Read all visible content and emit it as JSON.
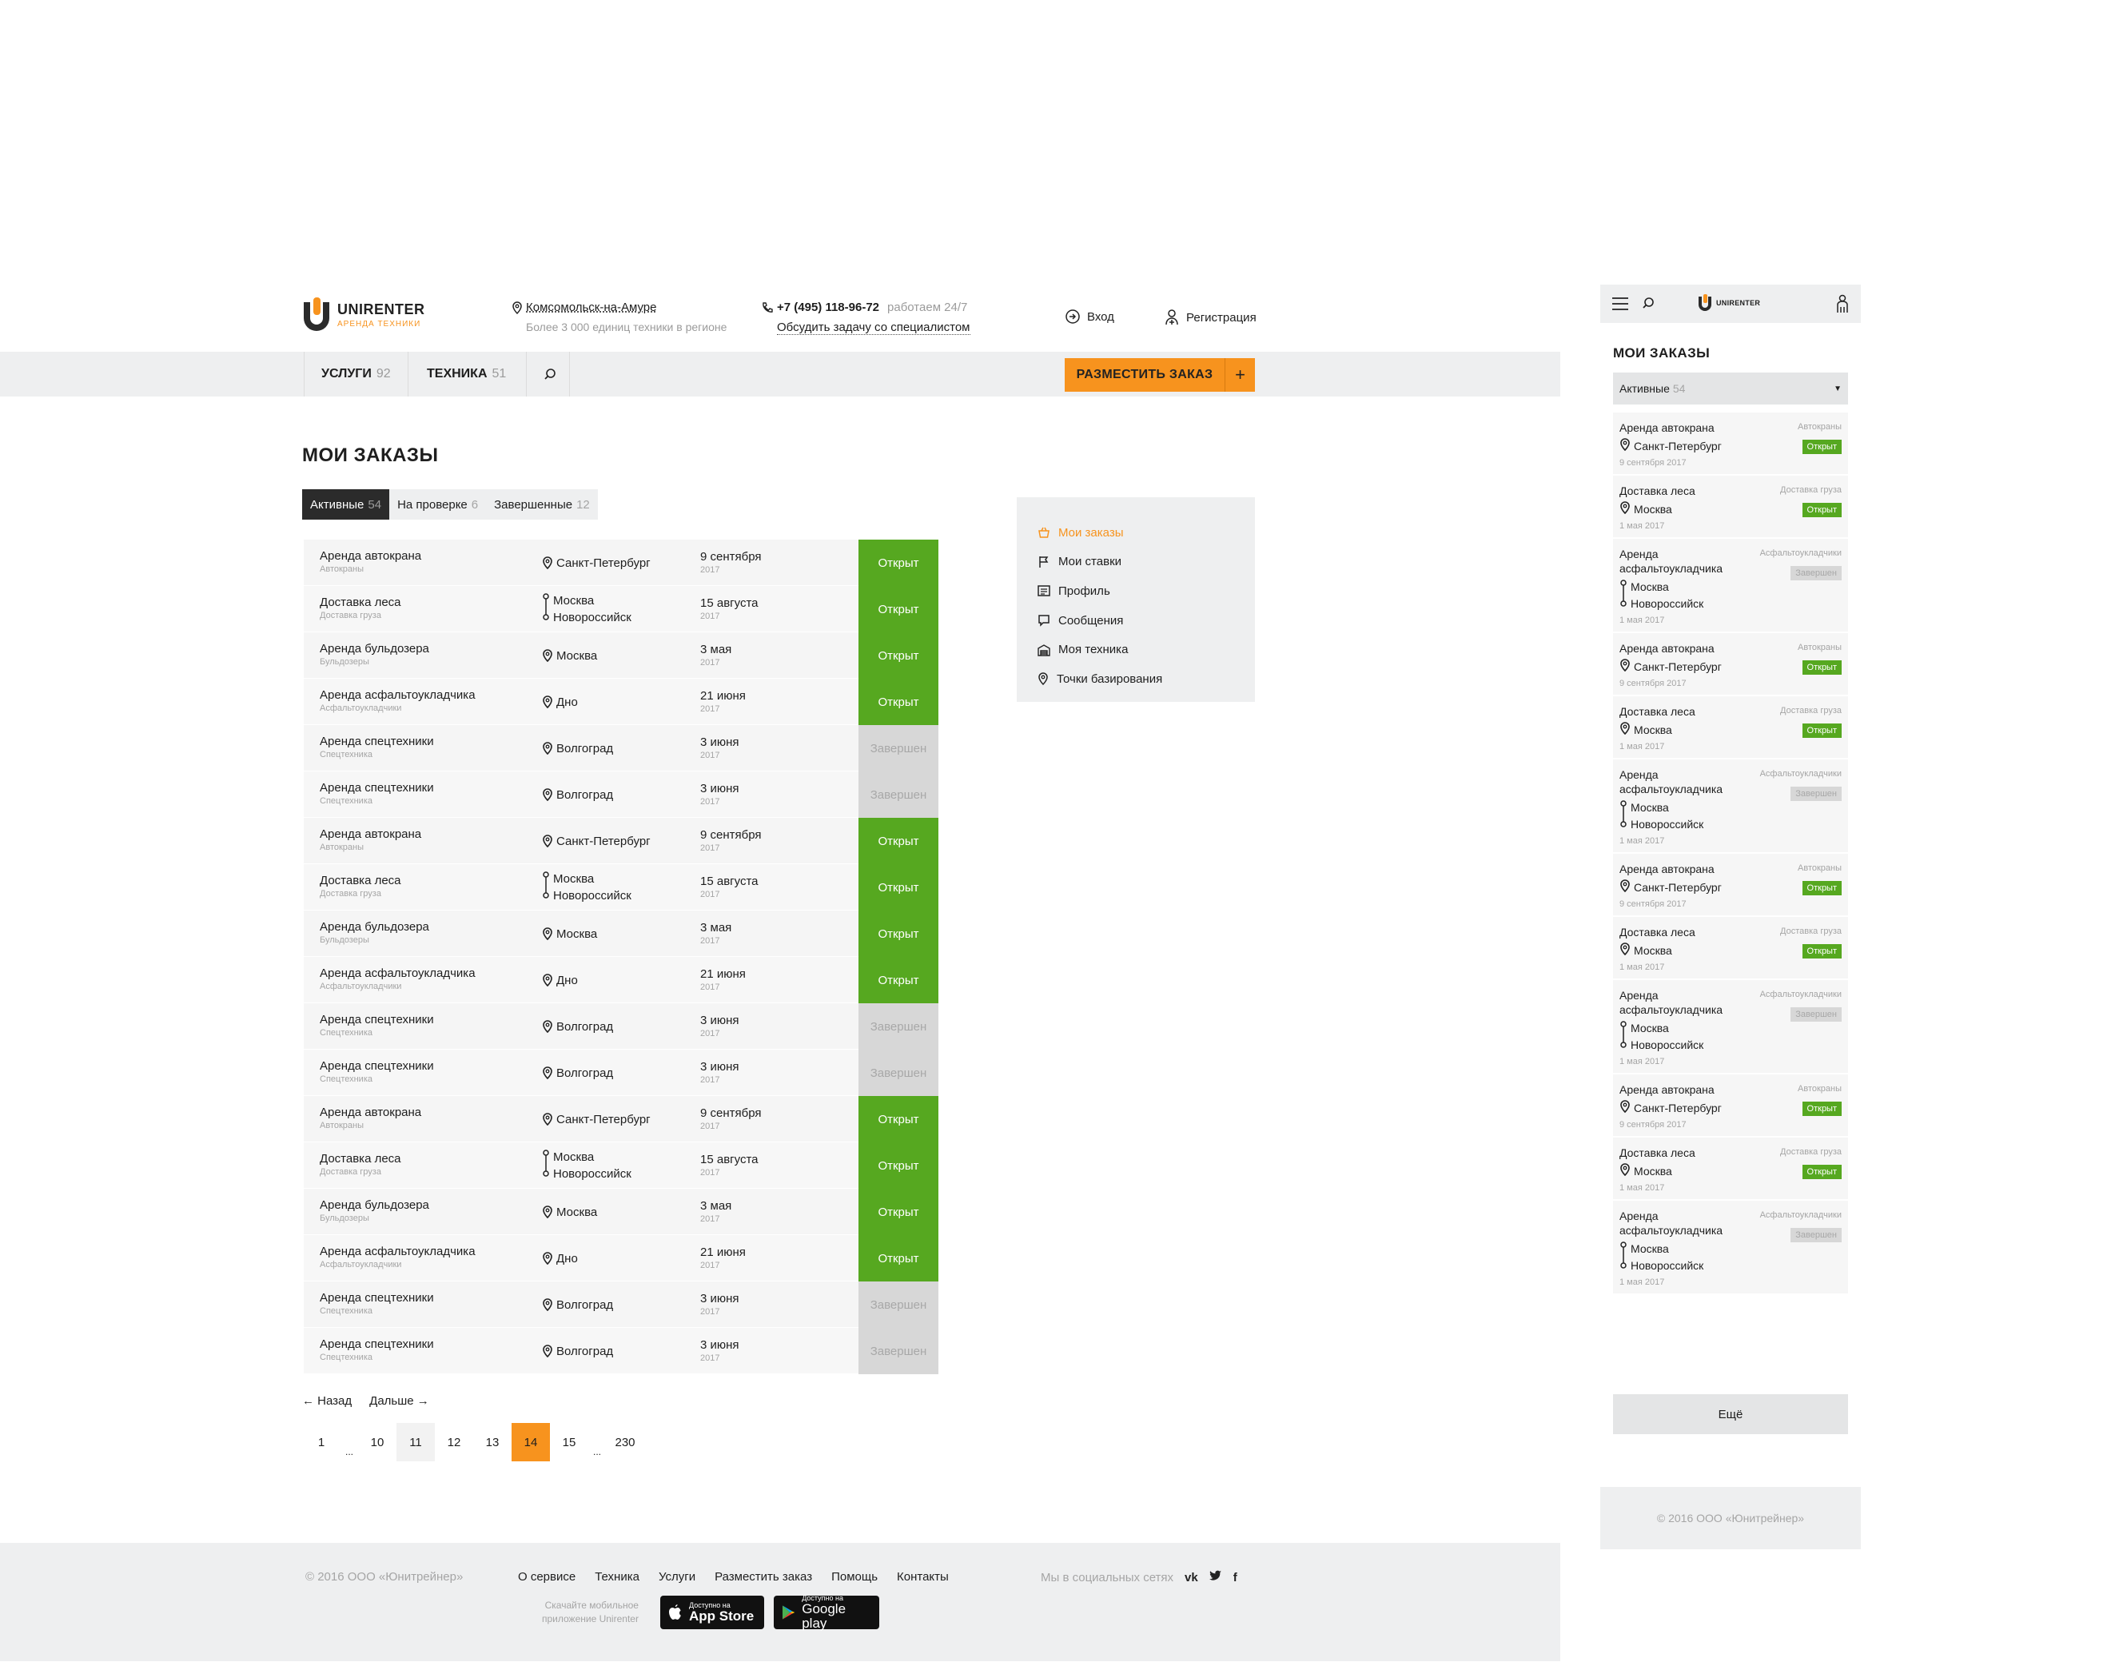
{
  "colors": {
    "accent": "#f7931e",
    "open": "#56a820",
    "done": "#d7d7d7",
    "dark": "#2b2b2b"
  },
  "header": {
    "logo_name": "UNIRENTER",
    "logo_sub": "АРЕНДА ТЕХНИКИ",
    "city": "Комсомольск-на-Амуре",
    "city_note": "Более 3 000 единиц техники в регионе",
    "phone": "+7 (495) 118-96-72",
    "phone_hours": "работаем 24/7",
    "phone_link": "Обсудить задачу со специалистом",
    "login": "Вход",
    "register": "Регистрация"
  },
  "nav": {
    "services": "УСЛУГИ",
    "services_count": "92",
    "equipment": "ТЕХНИКА",
    "equipment_count": "51",
    "place_order": "РАЗМЕСТИТЬ ЗАКАЗ",
    "plus": "+"
  },
  "main": {
    "title": "МОИ ЗАКАЗЫ",
    "tabs": [
      {
        "label": "Активные",
        "count": "54"
      },
      {
        "label": "На проверке",
        "count": "6"
      },
      {
        "label": "Завершенные",
        "count": "12"
      }
    ]
  },
  "orders": [
    {
      "title": "Аренда автокрана",
      "cat": "Автокраны",
      "from": "Санкт-Петербург",
      "to": "",
      "date": "9 сентября",
      "year": "2017",
      "status": "Открыт",
      "state": "open"
    },
    {
      "title": "Доставка леса",
      "cat": "Доставка груза",
      "from": "Москва",
      "to": "Новороссийск",
      "date": "15 августа",
      "year": "2017",
      "status": "Открыт",
      "state": "open"
    },
    {
      "title": "Аренда бульдозера",
      "cat": "Бульдозеры",
      "from": "Москва",
      "to": "",
      "date": "3 мая",
      "year": "2017",
      "status": "Открыт",
      "state": "open"
    },
    {
      "title": "Аренда асфальтоукладчика",
      "cat": "Асфальтоукладчики",
      "from": "Дно",
      "to": "",
      "date": "21 июня",
      "year": "2017",
      "status": "Открыт",
      "state": "open"
    },
    {
      "title": "Аренда спецтехники",
      "cat": "Спецтехника",
      "from": "Волгоград",
      "to": "",
      "date": "3 июня",
      "year": "2017",
      "status": "Завершен",
      "state": "done"
    },
    {
      "title": "Аренда спецтехники",
      "cat": "Спецтехника",
      "from": "Волгоград",
      "to": "",
      "date": "3 июня",
      "year": "2017",
      "status": "Завершен",
      "state": "done"
    },
    {
      "title": "Аренда автокрана",
      "cat": "Автокраны",
      "from": "Санкт-Петербург",
      "to": "",
      "date": "9 сентября",
      "year": "2017",
      "status": "Открыт",
      "state": "open"
    },
    {
      "title": "Доставка леса",
      "cat": "Доставка груза",
      "from": "Москва",
      "to": "Новороссийск",
      "date": "15 августа",
      "year": "2017",
      "status": "Открыт",
      "state": "open"
    },
    {
      "title": "Аренда бульдозера",
      "cat": "Бульдозеры",
      "from": "Москва",
      "to": "",
      "date": "3 мая",
      "year": "2017",
      "status": "Открыт",
      "state": "open"
    },
    {
      "title": "Аренда асфальтоукладчика",
      "cat": "Асфальтоукладчики",
      "from": "Дно",
      "to": "",
      "date": "21 июня",
      "year": "2017",
      "status": "Открыт",
      "state": "open"
    },
    {
      "title": "Аренда спецтехники",
      "cat": "Спецтехника",
      "from": "Волгоград",
      "to": "",
      "date": "3 июня",
      "year": "2017",
      "status": "Завершен",
      "state": "done"
    },
    {
      "title": "Аренда спецтехники",
      "cat": "Спецтехника",
      "from": "Волгоград",
      "to": "",
      "date": "3 июня",
      "year": "2017",
      "status": "Завершен",
      "state": "done"
    },
    {
      "title": "Аренда автокрана",
      "cat": "Автокраны",
      "from": "Санкт-Петербург",
      "to": "",
      "date": "9 сентября",
      "year": "2017",
      "status": "Открыт",
      "state": "open"
    },
    {
      "title": "Доставка леса",
      "cat": "Доставка груза",
      "from": "Москва",
      "to": "Новороссийск",
      "date": "15 августа",
      "year": "2017",
      "status": "Открыт",
      "state": "open"
    },
    {
      "title": "Аренда бульдозера",
      "cat": "Бульдозеры",
      "from": "Москва",
      "to": "",
      "date": "3 мая",
      "year": "2017",
      "status": "Открыт",
      "state": "open"
    },
    {
      "title": "Аренда асфальтоукладчика",
      "cat": "Асфальтоукладчики",
      "from": "Дно",
      "to": "",
      "date": "21 июня",
      "year": "2017",
      "status": "Открыт",
      "state": "open"
    },
    {
      "title": "Аренда спецтехники",
      "cat": "Спецтехника",
      "from": "Волгоград",
      "to": "",
      "date": "3 июня",
      "year": "2017",
      "status": "Завершен",
      "state": "done"
    },
    {
      "title": "Аренда спецтехники",
      "cat": "Спецтехника",
      "from": "Волгоград",
      "to": "",
      "date": "3 июня",
      "year": "2017",
      "status": "Завершен",
      "state": "done"
    }
  ],
  "pagination": {
    "prev": "← Назад",
    "next": "Дальше →",
    "pages": [
      {
        "label": "1",
        "kind": "plain"
      },
      {
        "label": "...",
        "kind": "dots"
      },
      {
        "label": "10",
        "kind": "plain"
      },
      {
        "label": "11",
        "kind": "light"
      },
      {
        "label": "12",
        "kind": "plain"
      },
      {
        "label": "13",
        "kind": "plain"
      },
      {
        "label": "14",
        "kind": "cur"
      },
      {
        "label": "15",
        "kind": "plain"
      },
      {
        "label": "...",
        "kind": "dots"
      },
      {
        "label": "230",
        "kind": "plain"
      }
    ]
  },
  "sidemenu": [
    {
      "label": "Мои заказы",
      "icon": "basket-icon",
      "active": true
    },
    {
      "label": "Мои ставки",
      "icon": "flag-icon",
      "active": false
    },
    {
      "label": "Профиль",
      "icon": "profile-icon",
      "active": false
    },
    {
      "label": "Сообщения",
      "icon": "message-icon",
      "active": false
    },
    {
      "label": "Моя техника",
      "icon": "garage-icon",
      "active": false
    },
    {
      "label": "Точки базирования",
      "icon": "location-pin-icon",
      "active": false
    }
  ],
  "footer": {
    "copyright": "© 2016 ООО «Юнитрейнер»",
    "links": [
      "О сервисе",
      "Техника",
      "Услуги",
      "Разместить заказ",
      "Помощь",
      "Контакты"
    ],
    "social_label": "Мы в социальных сетях",
    "social": [
      {
        "icon": "vk-icon",
        "glyph": "vk"
      },
      {
        "icon": "twitter-icon",
        "glyph": "t"
      },
      {
        "icon": "facebook-icon",
        "glyph": "f"
      }
    ],
    "app_note_1": "Скачайте мобильное",
    "app_note_2": "приложение Unirenter",
    "appstore_small": "Доступно на",
    "appstore": "App Store",
    "gplay_small": "Доступно на",
    "gplay": "Google play"
  },
  "mobile": {
    "logo_name": "UNIRENTER",
    "title": "МОИ ЗАКАЗЫ",
    "select_label": "Активные",
    "select_count": "54",
    "more": "Ещё",
    "copyright": "© 2016 ООО «Юнитрейнер»",
    "cards": [
      {
        "title": "Аренда автокрана",
        "cat": "Автокраны",
        "from": "Санкт-Петербург",
        "to": "",
        "date": "9 сентября 2017",
        "status": "Открыт",
        "state": "open"
      },
      {
        "title": "Доставка леса",
        "cat": "Доставка груза",
        "from": "Москва",
        "to": "",
        "date": "1 мая 2017",
        "status": "Открыт",
        "state": "open"
      },
      {
        "title": "Аренда асфальтоукладчика",
        "cat": "Асфальтоукладчики",
        "from": "Москва",
        "to": "Новороссийск",
        "date": "1 мая 2017",
        "status": "Завершен",
        "state": "done"
      },
      {
        "title": "Аренда автокрана",
        "cat": "Автокраны",
        "from": "Санкт-Петербург",
        "to": "",
        "date": "9 сентября 2017",
        "status": "Открыт",
        "state": "open"
      },
      {
        "title": "Доставка леса",
        "cat": "Доставка груза",
        "from": "Москва",
        "to": "",
        "date": "1 мая 2017",
        "status": "Открыт",
        "state": "open"
      },
      {
        "title": "Аренда асфальтоукладчика",
        "cat": "Асфальтоукладчики",
        "from": "Москва",
        "to": "Новороссийск",
        "date": "1 мая 2017",
        "status": "Завершен",
        "state": "done"
      },
      {
        "title": "Аренда автокрана",
        "cat": "Автокраны",
        "from": "Санкт-Петербург",
        "to": "",
        "date": "9 сентября 2017",
        "status": "Открыт",
        "state": "open"
      },
      {
        "title": "Доставка леса",
        "cat": "Доставка груза",
        "from": "Москва",
        "to": "",
        "date": "1 мая 2017",
        "status": "Открыт",
        "state": "open"
      },
      {
        "title": "Аренда асфальтоукладчика",
        "cat": "Асфальтоукладчики",
        "from": "Москва",
        "to": "Новороссийск",
        "date": "1 мая 2017",
        "status": "Завершен",
        "state": "done"
      },
      {
        "title": "Аренда автокрана",
        "cat": "Автокраны",
        "from": "Санкт-Петербург",
        "to": "",
        "date": "9 сентября 2017",
        "status": "Открыт",
        "state": "open"
      },
      {
        "title": "Доставка леса",
        "cat": "Доставка груза",
        "from": "Москва",
        "to": "",
        "date": "1 мая 2017",
        "status": "Открыт",
        "state": "open"
      },
      {
        "title": "Аренда асфальтоукладчика",
        "cat": "Асфальтоукладчики",
        "from": "Москва",
        "to": "Новороссийск",
        "date": "1 мая 2017",
        "status": "Завершен",
        "state": "done"
      }
    ]
  }
}
